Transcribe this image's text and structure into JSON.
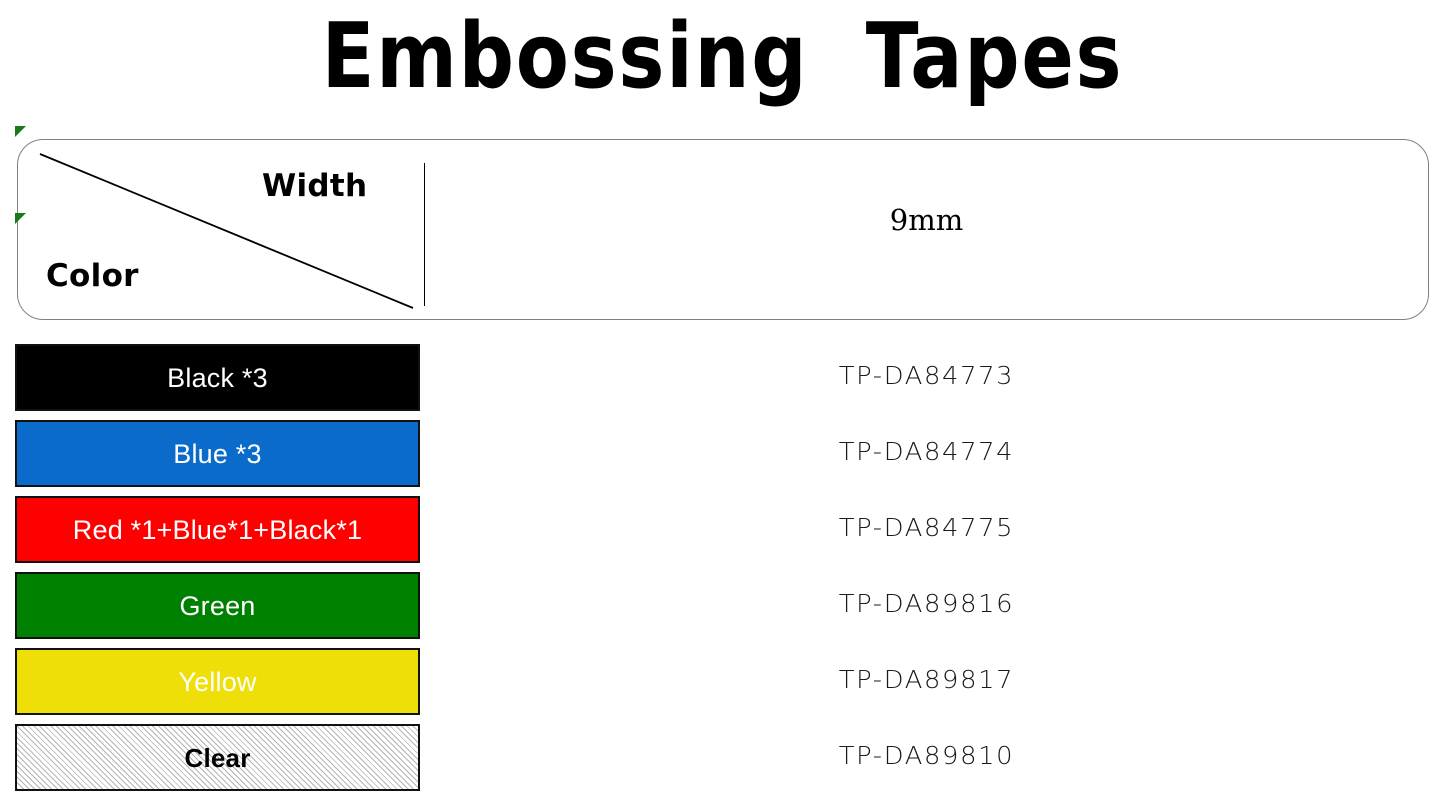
{
  "page": {
    "title": "Embossing  Tapes"
  },
  "header": {
    "axis_label_row": "Color",
    "axis_label_col": "Width",
    "width_value": "9mm",
    "markers": [
      {
        "name": "green-flag-top"
      },
      {
        "name": "green-flag-mid"
      }
    ]
  },
  "table": {
    "columns": [
      "Color",
      "9mm"
    ],
    "rows": [
      {
        "color_label": "Black *3",
        "swatch_color": "#000000",
        "text_color": "#ffffff",
        "pattern": "solid",
        "code": "TP-DA84773"
      },
      {
        "color_label": "Blue *3",
        "swatch_color": "#0a6bcb",
        "text_color": "#ffffff",
        "pattern": "solid",
        "code": "TP-DA84774"
      },
      {
        "color_label": "Red *1+Blue*1+Black*1",
        "swatch_color": "#fe0000",
        "text_color": "#ffffff",
        "pattern": "solid",
        "code": "TP-DA84775"
      },
      {
        "color_label": "Green",
        "swatch_color": "#008000",
        "text_color": "#ffffff",
        "pattern": "solid",
        "code": "TP-DA89816"
      },
      {
        "color_label": "Yellow",
        "swatch_color": "#eedf08",
        "text_color": "#ffffff",
        "pattern": "solid",
        "code": "TP-DA89817"
      },
      {
        "color_label": "Clear",
        "swatch_color": "#ffffff",
        "text_color": "#000000",
        "pattern": "diagonal-hatch",
        "code": "TP-DA89810"
      }
    ]
  },
  "colors": {
    "black": "#000000",
    "blue": "#0a6bcb",
    "red": "#fe0000",
    "green": "#008000",
    "yellow": "#eedf08",
    "clear_hatch": "#b4b4b4",
    "box_border": "#808080",
    "marker_green": "#1a7a1a"
  }
}
